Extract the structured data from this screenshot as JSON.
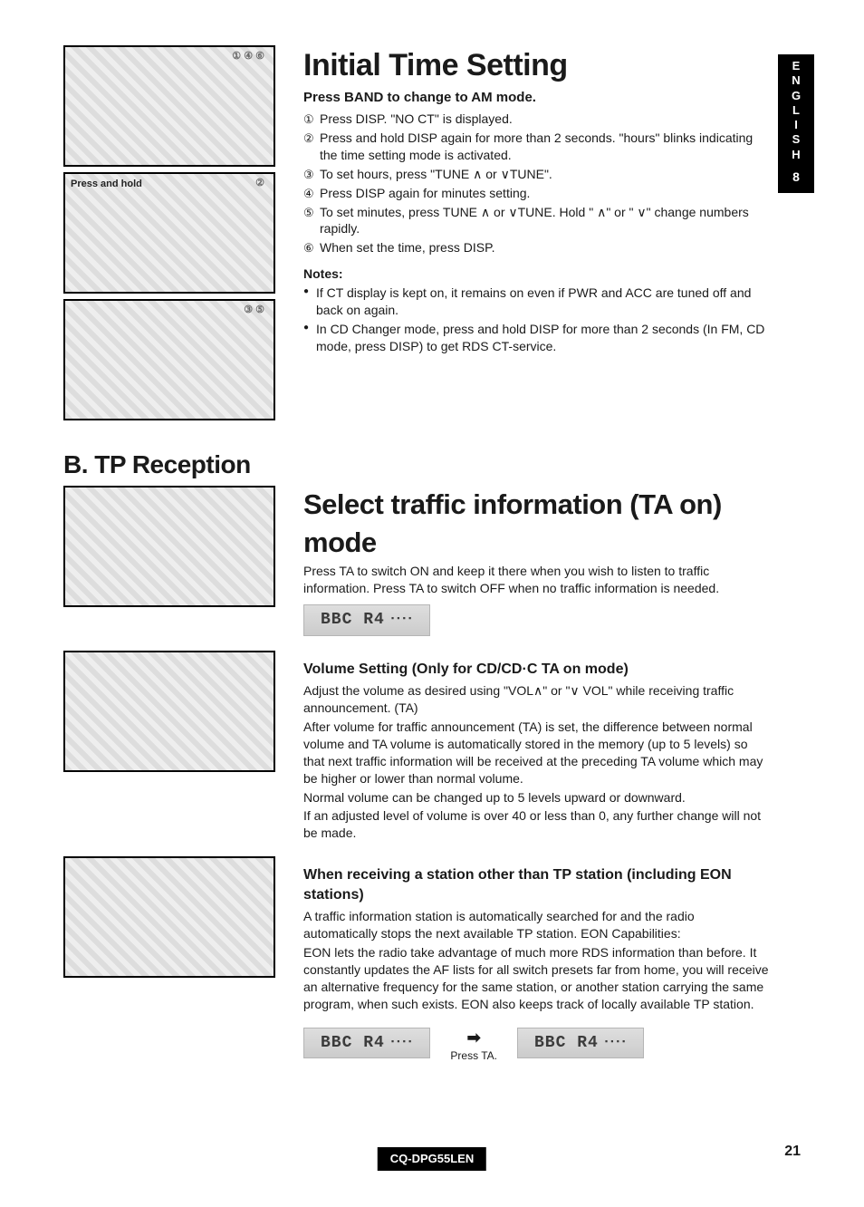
{
  "sideTab": {
    "letters": [
      "E",
      "N",
      "G",
      "L",
      "I",
      "S",
      "H"
    ],
    "page": "8"
  },
  "section1": {
    "title": "Initial Time Setting",
    "subtitle": "Press BAND to change to AM mode.",
    "steps": [
      "Press DISP. \"NO CT\" is displayed.",
      "Press and hold DISP again for more than 2 seconds. \"hours\" blinks indicating the time setting mode is activated.",
      "To set hours, press \"TUNE ∧ or ∨TUNE\".",
      "Press DISP again for minutes setting.",
      "To set minutes, press TUNE ∧ or ∨TUNE. Hold \" ∧\" or \" ∨\" change numbers rapidly.",
      "When set the time, press DISP."
    ],
    "notesHead": "Notes:",
    "notes": [
      "If CT display is kept on, it remains on even if PWR and ACC are tuned off and back on again.",
      "In CD Changer mode, press and hold DISP for more than 2 seconds (In FM, CD mode, press DISP) to get RDS CT-service."
    ],
    "figCallouts": [
      "① ④ ⑥",
      "②",
      "③ ⑤"
    ],
    "figLabel2": "Press and hold"
  },
  "sectionB": {
    "heading": "B. TP Reception",
    "title": "Select traffic information (TA on) mode",
    "intro": "Press TA to switch ON and keep it there when you wish to listen to traffic information. Press TA to switch OFF when no traffic information is needed.",
    "lcd1": "BBC R4",
    "volumeHead": "Volume Setting (Only for CD/CD·C TA on mode)",
    "volumeP1": "Adjust the volume as desired using \"VOL∧\" or \"∨ VOL\" while receiving traffic announcement. (TA)",
    "volumeP2": "After volume for traffic announcement (TA) is set, the difference between normal volume and TA volume is automatically stored in the memory (up to 5 levels) so that next traffic information will be received at the preceding TA volume which may be higher or lower than normal volume.",
    "volumeP3": "Normal volume can be changed up to 5 levels upward or downward.",
    "volumeP4": "If an adjusted level of volume is over 40 or less than 0, any further change will not be made.",
    "eonHead": "When receiving a station other than TP station (including EON stations)",
    "eonP1": "A traffic information station is automatically searched for and the radio automatically stops the next available TP station. EON Capabilities:",
    "eonP2": "EON lets the radio take advantage of much more RDS information than before. It constantly updates the AF lists for all switch presets far from home, you will receive an alternative frequency for the same station, or another station carrying the same program, when such exists. EON also keeps track of locally available TP station.",
    "lcd2a": "BBC R4",
    "arrowLabel": "Press TA.",
    "lcd2b": "BBC R4"
  },
  "footer": {
    "model": "CQ-DPG55LEN",
    "pageNo": "21"
  }
}
